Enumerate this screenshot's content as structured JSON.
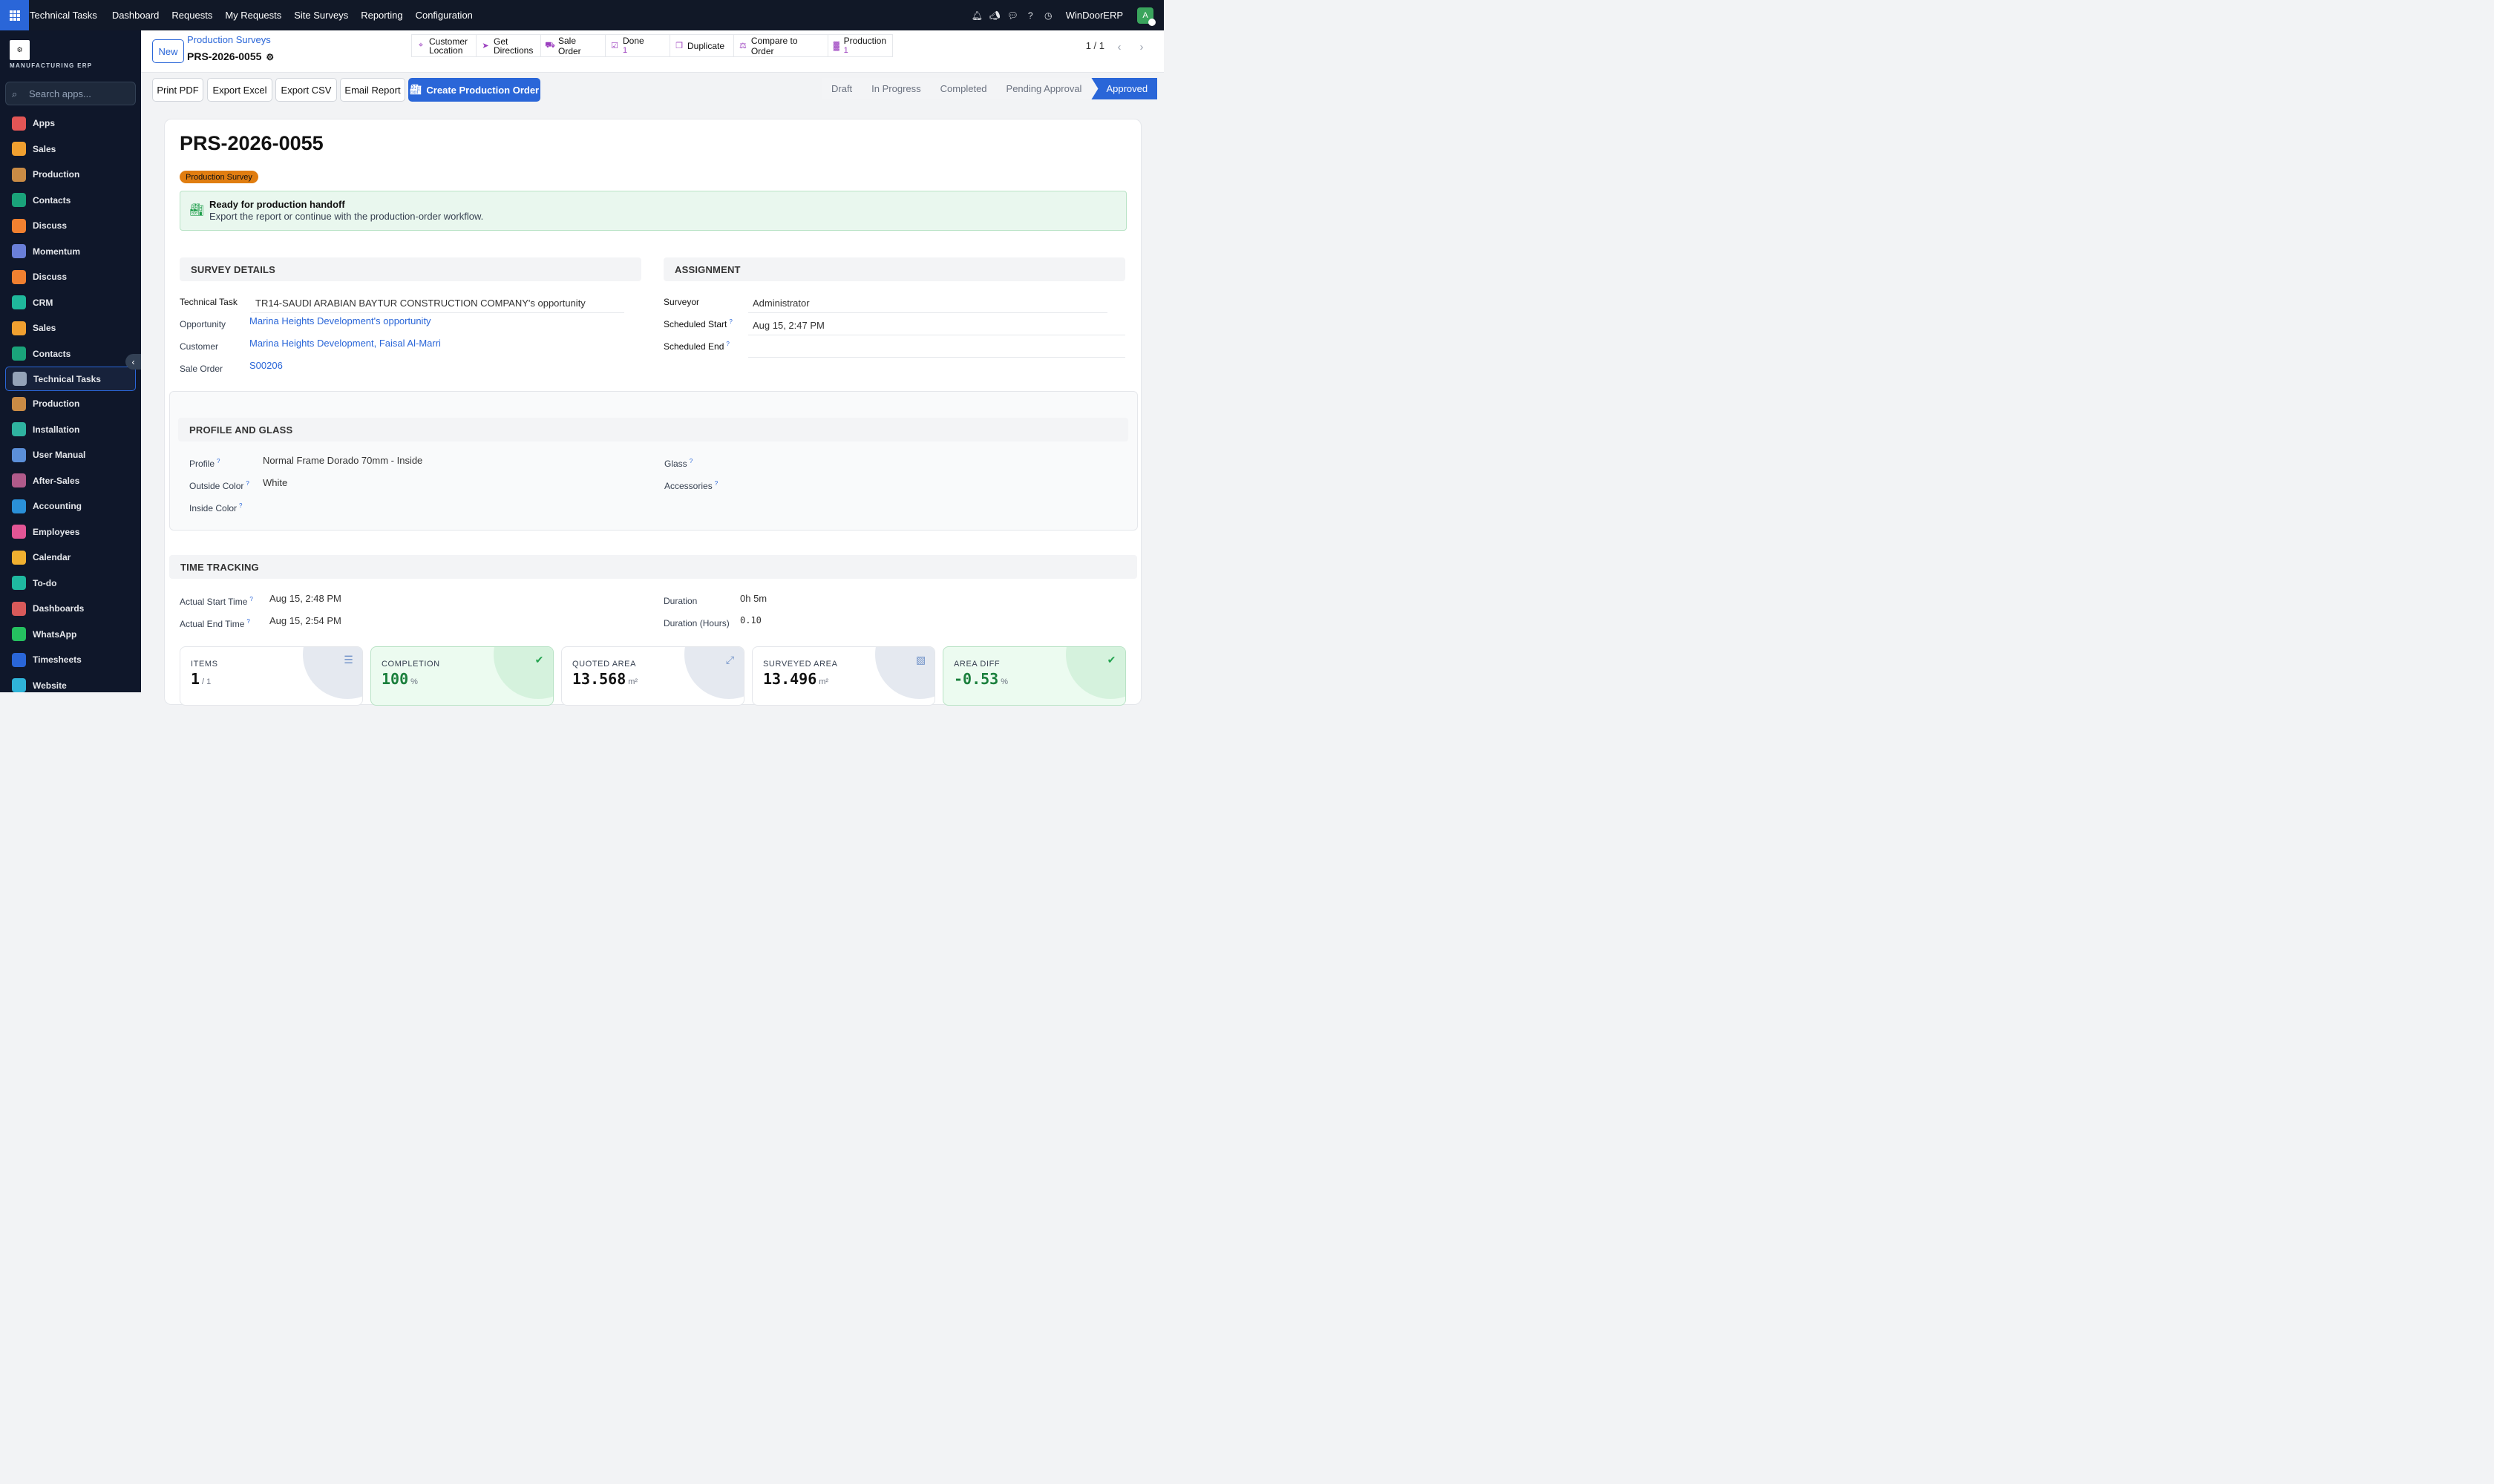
{
  "topnav": {
    "brand": "Technical Tasks",
    "menu": [
      "Dashboard",
      "Requests",
      "My Requests",
      "Site Surveys",
      "Reporting",
      "Configuration"
    ],
    "company": "WinDoorERP",
    "avatar_letter": "A"
  },
  "sidebar": {
    "logo_text": "MANUFACTURING ERP",
    "search_placeholder": "Search apps...",
    "items": [
      {
        "label": "Apps",
        "icon": "apps-icon",
        "color": "#e25555"
      },
      {
        "label": "Sales",
        "icon": "sales-icon",
        "color": "#f0a030"
      },
      {
        "label": "Production",
        "icon": "production-icon",
        "color": "#c98b45"
      },
      {
        "label": "Contacts",
        "icon": "contacts-icon",
        "color": "#1aa37a"
      },
      {
        "label": "Discuss",
        "icon": "discuss-icon",
        "color": "#f08030"
      },
      {
        "label": "Momentum",
        "icon": "momentum-icon",
        "color": "#6a7fd8"
      },
      {
        "label": "Discuss",
        "icon": "discuss-icon",
        "color": "#f08030"
      },
      {
        "label": "CRM",
        "icon": "crm-icon",
        "color": "#1fb89b"
      },
      {
        "label": "Sales",
        "icon": "sales-icon",
        "color": "#f0a030"
      },
      {
        "label": "Contacts",
        "icon": "contacts-icon",
        "color": "#1aa37a"
      },
      {
        "label": "Technical Tasks",
        "icon": "technical-tasks-icon",
        "color": "#94a3b8"
      },
      {
        "label": "Production",
        "icon": "production-icon",
        "color": "#c98b45"
      },
      {
        "label": "Installation",
        "icon": "installation-icon",
        "color": "#2fb3a0"
      },
      {
        "label": "User Manual",
        "icon": "user-manual-icon",
        "color": "#5b8fd8"
      },
      {
        "label": "After-Sales",
        "icon": "after-sales-icon",
        "color": "#b05a8a"
      },
      {
        "label": "Accounting",
        "icon": "accounting-icon",
        "color": "#2a90d8"
      },
      {
        "label": "Employees",
        "icon": "employees-icon",
        "color": "#e25595"
      },
      {
        "label": "Calendar",
        "icon": "calendar-icon",
        "color": "#f0b030"
      },
      {
        "label": "To-do",
        "icon": "todo-icon",
        "color": "#1fb8a0"
      },
      {
        "label": "Dashboards",
        "icon": "dashboards-icon",
        "color": "#d85a5a"
      },
      {
        "label": "WhatsApp",
        "icon": "whatsapp-icon",
        "color": "#25c060"
      },
      {
        "label": "Timesheets",
        "icon": "timesheets-icon",
        "color": "#2a66d8"
      },
      {
        "label": "Website",
        "icon": "website-icon",
        "color": "#2fb3d8"
      }
    ]
  },
  "control": {
    "new_label": "New",
    "breadcrumb_parent": "Production Surveys",
    "breadcrumb_current": "PRS-2026-0055",
    "smart_buttons": [
      {
        "label": "Customer",
        "label2": "Location",
        "icon": "map-pin-icon"
      },
      {
        "label": "Get",
        "label2": "Directions",
        "icon": "navigation-icon"
      },
      {
        "label": "Sale Order",
        "label2": "",
        "icon": "cart-icon"
      },
      {
        "label": "Done",
        "label2": "1",
        "icon": "checklist-icon"
      },
      {
        "label": "Duplicate",
        "label2": "",
        "icon": "duplicate-icon"
      },
      {
        "label": "Compare to Order",
        "label2": "",
        "icon": "scale-icon"
      },
      {
        "label": "Production",
        "label2": "1",
        "icon": "factory-icon"
      }
    ],
    "pager": "1 / 1"
  },
  "actions": [
    "Print PDF",
    "Export Excel",
    "Export CSV",
    "Email Report"
  ],
  "primary_action": "Create Production Order",
  "statusbar": [
    "Draft",
    "In Progress",
    "Completed",
    "Pending Approval",
    "Approved"
  ],
  "record": {
    "title": "PRS-2026-0055",
    "badge": "Production Survey",
    "alert_title": "Ready for production handoff",
    "alert_text": "Export the report or continue with the production-order workflow."
  },
  "survey": {
    "heading": "SURVEY DETAILS",
    "technical_task_label": "Technical Task",
    "technical_task": "TR14-SAUDI ARABIAN BAYTUR CONSTRUCTION COMPANY's opportunity",
    "opportunity_label": "Opportunity",
    "opportunity": "Marina Heights Development's opportunity",
    "customer_label": "Customer",
    "customer": "Marina Heights Development, Faisal Al-Marri",
    "sale_order_label": "Sale Order",
    "sale_order": "S00206"
  },
  "assignment": {
    "heading": "ASSIGNMENT",
    "surveyor_label": "Surveyor",
    "surveyor": "Administrator",
    "start_label": "Scheduled Start",
    "start": "Aug 15, 2:47 PM",
    "end_label": "Scheduled End",
    "end": ""
  },
  "profile": {
    "heading": "PROFILE AND GLASS",
    "profile_label": "Profile",
    "profile": "Normal Frame Dorado 70mm - Inside",
    "outside_label": "Outside Color",
    "outside": "White",
    "inside_label": "Inside Color",
    "inside": "",
    "glass_label": "Glass",
    "accessories_label": "Accessories"
  },
  "time": {
    "heading": "TIME TRACKING",
    "start_label": "Actual Start Time",
    "start": "Aug 15, 2:48 PM",
    "end_label": "Actual End Time",
    "end": "Aug 15, 2:54 PM",
    "duration_label": "Duration",
    "duration": "0h 5m",
    "hours_label": "Duration (Hours)",
    "hours": "0.10"
  },
  "kpis": [
    {
      "label": "ITEMS",
      "value": "1",
      "unit": "/ 1",
      "icon": "list-icon",
      "green": false
    },
    {
      "label": "COMPLETION",
      "value": "100",
      "unit": "%",
      "icon": "check-circle-icon",
      "green": true
    },
    {
      "label": "QUOTED AREA",
      "value": "13.568",
      "unit": "m²",
      "icon": "expand-icon",
      "green": false
    },
    {
      "label": "SURVEYED AREA",
      "value": "13.496",
      "unit": "m²",
      "icon": "map-icon",
      "green": false
    },
    {
      "label": "AREA DIFF",
      "value": "-0.53",
      "unit": "%",
      "icon": "check-icon",
      "green": true
    }
  ]
}
